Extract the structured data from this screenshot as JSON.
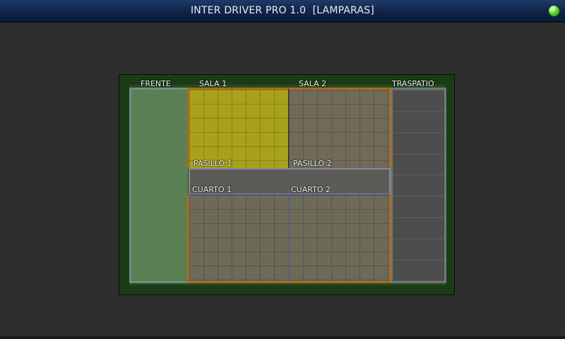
{
  "window": {
    "title": "INTER DRIVER PRO 1.0  [LAMPARAS]",
    "status_color": "#3fc321"
  },
  "floorplan": {
    "zones": {
      "frente": "FRENTE",
      "sala1": "SALA 1",
      "sala2": "SALA 2",
      "traspatio": "TRASPATIO",
      "pasillo1": "PASILLO 1",
      "pasillo2": "PASILLO 2",
      "cuarto1": "CUARTO 1",
      "cuarto2": "CUARTO 2"
    },
    "active_zone": "SALA 1",
    "colors": {
      "active": "#a8a11c",
      "inactive": "#6e6a5a",
      "room_border": "#b06a1f",
      "lawn": "#264b20"
    }
  }
}
